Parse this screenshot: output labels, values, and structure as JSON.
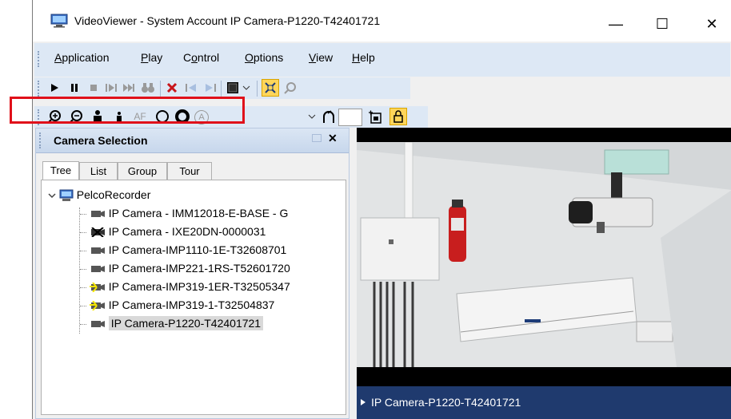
{
  "window": {
    "title": "VideoViewer - System Account IP Camera-P1220-T42401721"
  },
  "caption_buttons": {
    "minimize": "—",
    "maximize": "☐",
    "close": "✕"
  },
  "menu": [
    {
      "label": "Application",
      "u": "A",
      "rest": "pplication"
    },
    {
      "label": "Play",
      "u": "P",
      "rest": "lay"
    },
    {
      "label": "Control",
      "pre": "C",
      "u": "o",
      "rest": "ntrol"
    },
    {
      "label": "Options",
      "u": "O",
      "rest": "ptions"
    },
    {
      "label": "View",
      "u": "V",
      "rest": "iew"
    },
    {
      "label": "Help",
      "u": "H",
      "rest": "elp"
    }
  ],
  "panel": {
    "title": "Camera Selection",
    "close": "✕",
    "tabs": [
      "Tree",
      "List",
      "Group",
      "Tour"
    ],
    "root": "PelcoRecorder",
    "cameras": [
      "IP Camera - IMM12018-E-BASE - G",
      "IP Camera - IXE20DN-0000031",
      "IP Camera-IMP1110-1E-T32608701",
      "IP Camera-IMP221-1RS-T52601720",
      "IP Camera-IMP319-1ER-T32505347",
      "IP Camera-IMP319-1-T32504837",
      "IP Camera-P1220-T42401721"
    ]
  },
  "toolbar": {
    "af_label": "AF",
    "a_label": "A"
  },
  "video": {
    "status_label": "IP Camera-P1220-T42401721"
  },
  "colors": {
    "highlight": "#e0101a",
    "status_bar": "#1f3a6e",
    "menu_bg": "#dde8f5"
  }
}
